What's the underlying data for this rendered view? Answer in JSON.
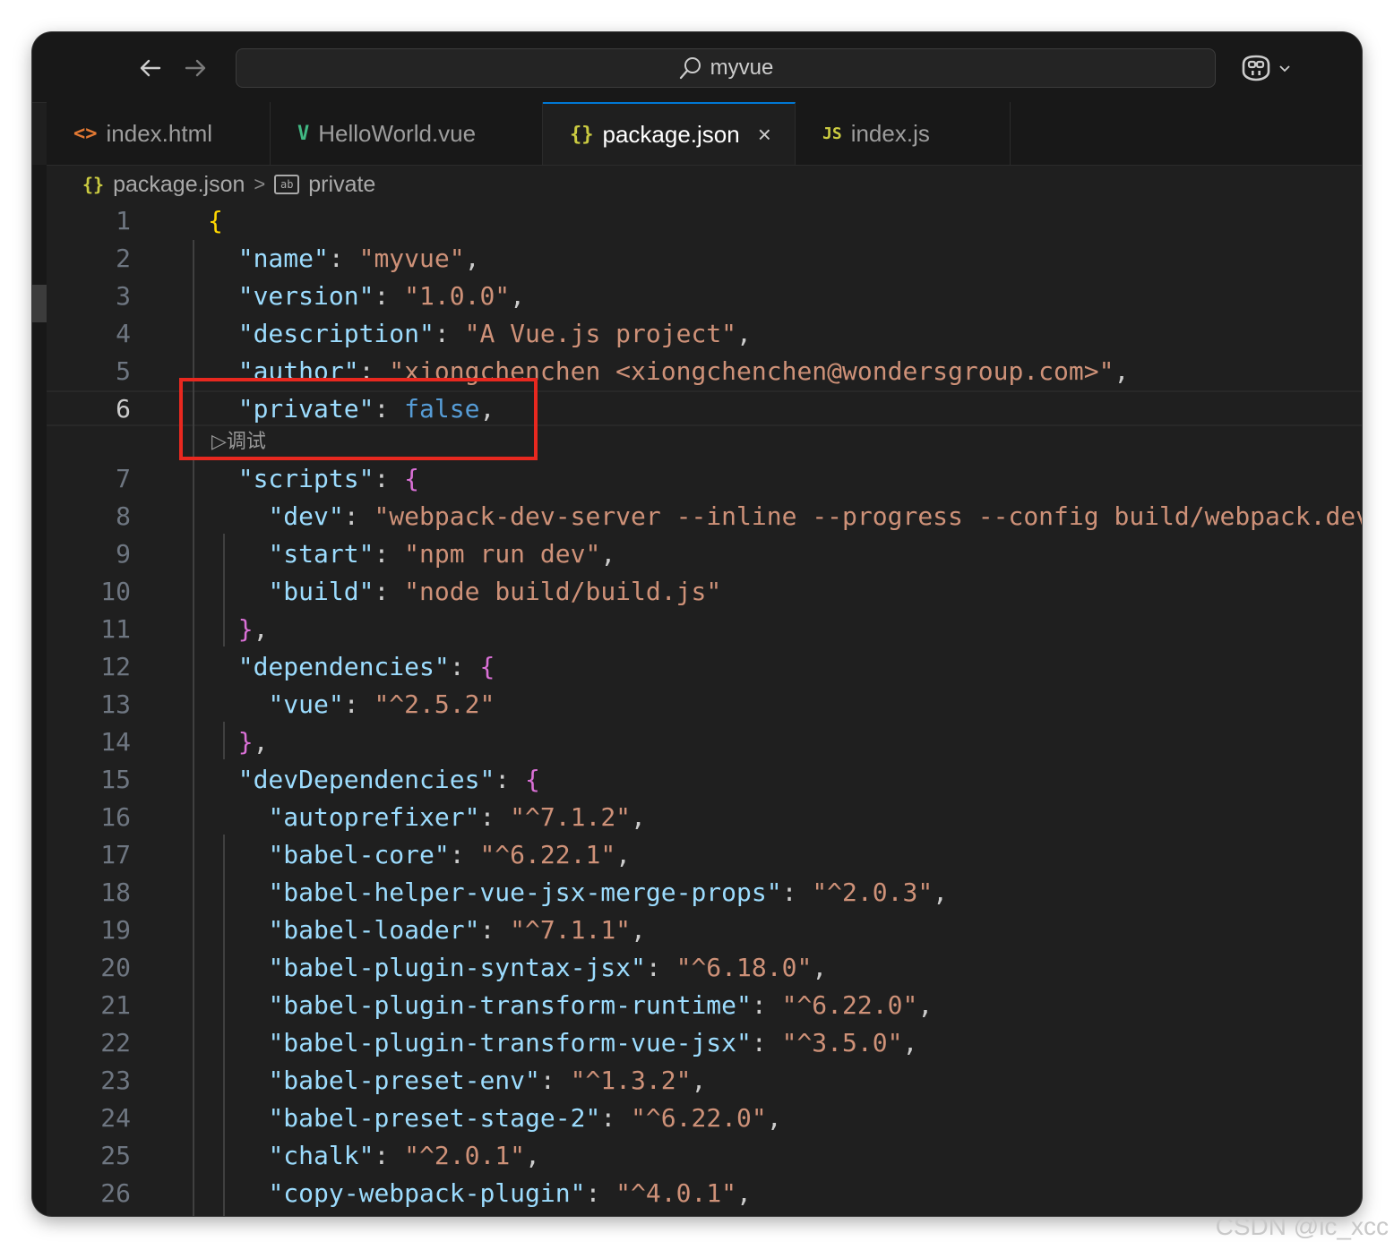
{
  "titlebar": {
    "search_text": "myvue",
    "back_icon": "arrow-left-icon",
    "forward_icon": "arrow-right-icon",
    "copilot_icon": "copilot-icon"
  },
  "tabs": [
    {
      "icon": "<>",
      "label": "index.html",
      "icon_color": "#e37933"
    },
    {
      "icon": "V",
      "label": "HelloWorld.vue",
      "icon_color": "#41b883"
    },
    {
      "icon": "{}",
      "label": "package.json",
      "icon_color": "#cbcb41",
      "active": true
    },
    {
      "icon": "JS",
      "label": "index.js",
      "icon_color": "#cbcb41"
    }
  ],
  "tab_close": "×",
  "breadcrumb": {
    "file_icon": "{}",
    "file": "package.json",
    "separator": ">",
    "symbol": "private"
  },
  "codelens": "▷调试",
  "lines": [
    {
      "n": "1",
      "tokens": [
        {
          "t": "{",
          "c": "b1"
        }
      ]
    },
    {
      "n": "2",
      "tokens": [
        {
          "t": "  "
        },
        {
          "t": "\"name\"",
          "c": "k"
        },
        {
          "t": ": ",
          "c": "p"
        },
        {
          "t": "\"myvue\"",
          "c": "s"
        },
        {
          "t": ",",
          "c": "p"
        }
      ]
    },
    {
      "n": "3",
      "tokens": [
        {
          "t": "  "
        },
        {
          "t": "\"version\"",
          "c": "k"
        },
        {
          "t": ": ",
          "c": "p"
        },
        {
          "t": "\"1.0.0\"",
          "c": "s"
        },
        {
          "t": ",",
          "c": "p"
        }
      ]
    },
    {
      "n": "4",
      "tokens": [
        {
          "t": "  "
        },
        {
          "t": "\"description\"",
          "c": "k"
        },
        {
          "t": ": ",
          "c": "p"
        },
        {
          "t": "\"A Vue.js project\"",
          "c": "s"
        },
        {
          "t": ",",
          "c": "p"
        }
      ]
    },
    {
      "n": "5",
      "tokens": [
        {
          "t": "  "
        },
        {
          "t": "\"author\"",
          "c": "k"
        },
        {
          "t": ": ",
          "c": "p"
        },
        {
          "t": "\"xiongchenchen <xiongchenchen@wondersgroup.com>\"",
          "c": "s"
        },
        {
          "t": ",",
          "c": "p"
        }
      ]
    },
    {
      "n": "6",
      "current": true,
      "tokens": [
        {
          "t": "  "
        },
        {
          "t": "\"private\"",
          "c": "k"
        },
        {
          "t": ": ",
          "c": "p"
        },
        {
          "t": "false",
          "c": "kw"
        },
        {
          "t": ",",
          "c": "p"
        }
      ]
    },
    {
      "n": "7",
      "tokens": [
        {
          "t": "  "
        },
        {
          "t": "\"scripts\"",
          "c": "k"
        },
        {
          "t": ": ",
          "c": "p"
        },
        {
          "t": "{",
          "c": "b2"
        }
      ]
    },
    {
      "n": "8",
      "tokens": [
        {
          "t": "    "
        },
        {
          "t": "\"dev\"",
          "c": "k"
        },
        {
          "t": ": ",
          "c": "p"
        },
        {
          "t": "\"webpack-dev-server --inline --progress --config build/webpack.dev.conf.js\"",
          "c": "s"
        },
        {
          "t": ",",
          "c": "p"
        }
      ]
    },
    {
      "n": "9",
      "tokens": [
        {
          "t": "    "
        },
        {
          "t": "\"start\"",
          "c": "k"
        },
        {
          "t": ": ",
          "c": "p"
        },
        {
          "t": "\"npm run dev\"",
          "c": "s"
        },
        {
          "t": ",",
          "c": "p"
        }
      ]
    },
    {
      "n": "10",
      "tokens": [
        {
          "t": "    "
        },
        {
          "t": "\"build\"",
          "c": "k"
        },
        {
          "t": ": ",
          "c": "p"
        },
        {
          "t": "\"node build/build.js\"",
          "c": "s"
        }
      ]
    },
    {
      "n": "11",
      "tokens": [
        {
          "t": "  "
        },
        {
          "t": "}",
          "c": "b2"
        },
        {
          "t": ",",
          "c": "p"
        }
      ]
    },
    {
      "n": "12",
      "tokens": [
        {
          "t": "  "
        },
        {
          "t": "\"dependencies\"",
          "c": "k"
        },
        {
          "t": ": ",
          "c": "p"
        },
        {
          "t": "{",
          "c": "b2"
        }
      ]
    },
    {
      "n": "13",
      "tokens": [
        {
          "t": "    "
        },
        {
          "t": "\"vue\"",
          "c": "k"
        },
        {
          "t": ": ",
          "c": "p"
        },
        {
          "t": "\"^2.5.2\"",
          "c": "s"
        }
      ]
    },
    {
      "n": "14",
      "tokens": [
        {
          "t": "  "
        },
        {
          "t": "}",
          "c": "b2"
        },
        {
          "t": ",",
          "c": "p"
        }
      ]
    },
    {
      "n": "15",
      "tokens": [
        {
          "t": "  "
        },
        {
          "t": "\"devDependencies\"",
          "c": "k"
        },
        {
          "t": ": ",
          "c": "p"
        },
        {
          "t": "{",
          "c": "b2"
        }
      ]
    },
    {
      "n": "16",
      "tokens": [
        {
          "t": "    "
        },
        {
          "t": "\"autoprefixer\"",
          "c": "k"
        },
        {
          "t": ": ",
          "c": "p"
        },
        {
          "t": "\"^7.1.2\"",
          "c": "s"
        },
        {
          "t": ",",
          "c": "p"
        }
      ]
    },
    {
      "n": "17",
      "tokens": [
        {
          "t": "    "
        },
        {
          "t": "\"babel-core\"",
          "c": "k"
        },
        {
          "t": ": ",
          "c": "p"
        },
        {
          "t": "\"^6.22.1\"",
          "c": "s"
        },
        {
          "t": ",",
          "c": "p"
        }
      ]
    },
    {
      "n": "18",
      "tokens": [
        {
          "t": "    "
        },
        {
          "t": "\"babel-helper-vue-jsx-merge-props\"",
          "c": "k"
        },
        {
          "t": ": ",
          "c": "p"
        },
        {
          "t": "\"^2.0.3\"",
          "c": "s"
        },
        {
          "t": ",",
          "c": "p"
        }
      ]
    },
    {
      "n": "19",
      "tokens": [
        {
          "t": "    "
        },
        {
          "t": "\"babel-loader\"",
          "c": "k"
        },
        {
          "t": ": ",
          "c": "p"
        },
        {
          "t": "\"^7.1.1\"",
          "c": "s"
        },
        {
          "t": ",",
          "c": "p"
        }
      ]
    },
    {
      "n": "20",
      "tokens": [
        {
          "t": "    "
        },
        {
          "t": "\"babel-plugin-syntax-jsx\"",
          "c": "k"
        },
        {
          "t": ": ",
          "c": "p"
        },
        {
          "t": "\"^6.18.0\"",
          "c": "s"
        },
        {
          "t": ",",
          "c": "p"
        }
      ]
    },
    {
      "n": "21",
      "tokens": [
        {
          "t": "    "
        },
        {
          "t": "\"babel-plugin-transform-runtime\"",
          "c": "k"
        },
        {
          "t": ": ",
          "c": "p"
        },
        {
          "t": "\"^6.22.0\"",
          "c": "s"
        },
        {
          "t": ",",
          "c": "p"
        }
      ]
    },
    {
      "n": "22",
      "tokens": [
        {
          "t": "    "
        },
        {
          "t": "\"babel-plugin-transform-vue-jsx\"",
          "c": "k"
        },
        {
          "t": ": ",
          "c": "p"
        },
        {
          "t": "\"^3.5.0\"",
          "c": "s"
        },
        {
          "t": ",",
          "c": "p"
        }
      ]
    },
    {
      "n": "23",
      "tokens": [
        {
          "t": "    "
        },
        {
          "t": "\"babel-preset-env\"",
          "c": "k"
        },
        {
          "t": ": ",
          "c": "p"
        },
        {
          "t": "\"^1.3.2\"",
          "c": "s"
        },
        {
          "t": ",",
          "c": "p"
        }
      ]
    },
    {
      "n": "24",
      "tokens": [
        {
          "t": "    "
        },
        {
          "t": "\"babel-preset-stage-2\"",
          "c": "k"
        },
        {
          "t": ": ",
          "c": "p"
        },
        {
          "t": "\"^6.22.0\"",
          "c": "s"
        },
        {
          "t": ",",
          "c": "p"
        }
      ]
    },
    {
      "n": "25",
      "tokens": [
        {
          "t": "    "
        },
        {
          "t": "\"chalk\"",
          "c": "k"
        },
        {
          "t": ": ",
          "c": "p"
        },
        {
          "t": "\"^2.0.1\"",
          "c": "s"
        },
        {
          "t": ",",
          "c": "p"
        }
      ]
    },
    {
      "n": "26",
      "tokens": [
        {
          "t": "    "
        },
        {
          "t": "\"copy-webpack-plugin\"",
          "c": "k"
        },
        {
          "t": ": ",
          "c": "p"
        },
        {
          "t": "\"^4.0.1\"",
          "c": "s"
        },
        {
          "t": ",",
          "c": "p"
        }
      ]
    }
  ],
  "watermark": "CSDN @ic_xcc",
  "colors": {
    "accent": "#0078d4",
    "highlight_box": "#e8281f",
    "editor_bg": "#1f1f1f"
  }
}
